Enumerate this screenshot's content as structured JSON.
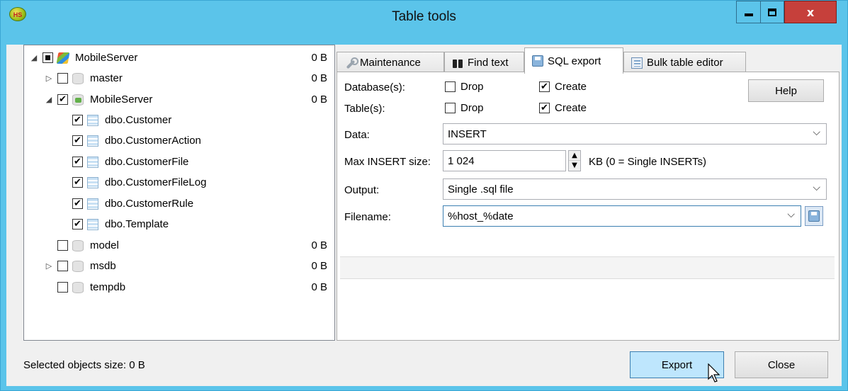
{
  "window": {
    "title": "Table tools",
    "app_icon": "HS",
    "close_glyph": "x"
  },
  "tree": {
    "items": [
      {
        "label": "MobileServer",
        "size": "0 B",
        "state": "partial",
        "expander": "◢",
        "icon": "server-icon"
      },
      {
        "label": "master",
        "size": "0 B",
        "state": "unchecked",
        "expander": "▷",
        "icon": "database-icon"
      },
      {
        "label": "MobileServer",
        "size": "0 B",
        "state": "checked",
        "expander": "◢",
        "icon": "database-icon"
      },
      {
        "label": "dbo.Customer",
        "state": "checked",
        "icon": "table-icon"
      },
      {
        "label": "dbo.CustomerAction",
        "state": "checked",
        "icon": "table-icon"
      },
      {
        "label": "dbo.CustomerFile",
        "state": "checked",
        "icon": "table-icon"
      },
      {
        "label": "dbo.CustomerFileLog",
        "state": "checked",
        "icon": "table-icon"
      },
      {
        "label": "dbo.CustomerRule",
        "state": "checked",
        "icon": "table-icon"
      },
      {
        "label": "dbo.Template",
        "state": "checked",
        "icon": "table-icon"
      },
      {
        "label": "model",
        "size": "0 B",
        "state": "unchecked",
        "icon": "database-icon"
      },
      {
        "label": "msdb",
        "size": "0 B",
        "state": "unchecked",
        "expander": "▷",
        "icon": "database-icon"
      },
      {
        "label": "tempdb",
        "size": "0 B",
        "state": "unchecked",
        "icon": "database-icon"
      }
    ]
  },
  "tabs": [
    {
      "label": "Maintenance",
      "icon": "wrench-icon"
    },
    {
      "label": "Find text",
      "icon": "binoculars-icon"
    },
    {
      "label": "SQL export",
      "icon": "save-disk-icon",
      "active": true
    },
    {
      "label": "Bulk table editor",
      "icon": "sheets-icon"
    }
  ],
  "sql_export": {
    "database_label": "Database(s):",
    "table_label": "Table(s):",
    "drop_label": "Drop",
    "create_label": "Create",
    "help_label": "Help",
    "data_label": "Data:",
    "data_value": "INSERT",
    "max_insert_label": "Max INSERT size:",
    "max_insert_value": "1 024",
    "max_insert_unit": "KB (0 = Single INSERTs)",
    "output_label": "Output:",
    "output_value": "Single .sql file",
    "filename_label": "Filename:",
    "filename_value": "%host_%date"
  },
  "footer": {
    "status": "Selected objects size: 0 B",
    "export_label": "Export",
    "close_label": "Close"
  },
  "glyphs": {
    "check": "✔",
    "chevron": "⌵",
    "up": "▲",
    "down": "▼"
  }
}
